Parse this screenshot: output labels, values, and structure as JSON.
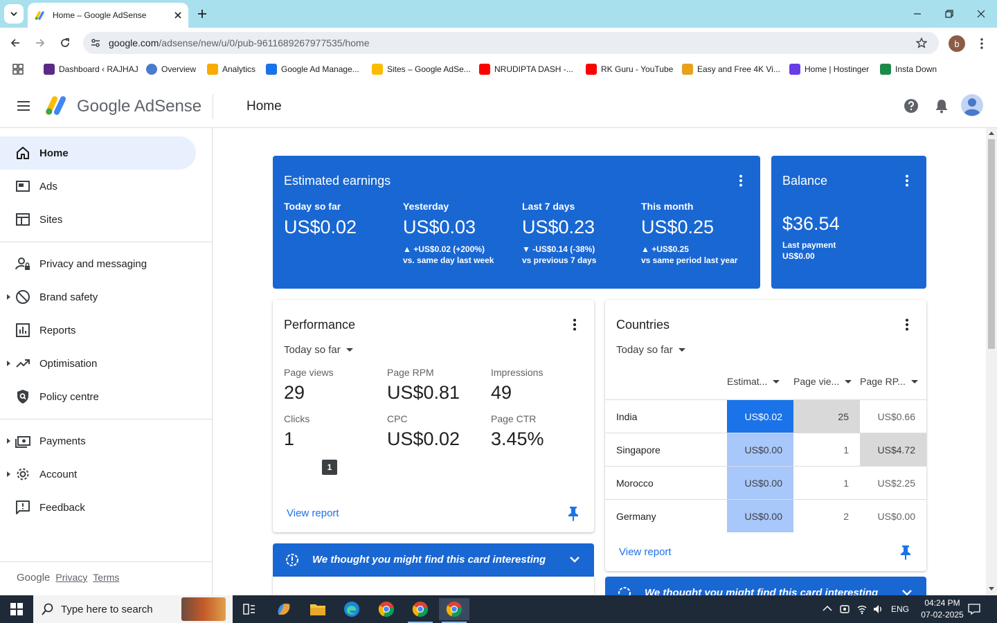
{
  "browser": {
    "tab_title": "Home – Google AdSense",
    "url_host": "google.com",
    "url_path": "/adsense/new/u/0/pub-9611689267977535/home",
    "profile_initial": "b"
  },
  "bookmarks": [
    {
      "label": "Dashboard ‹ RAJHAJ",
      "icon": "wordpress-icon",
      "color": "#5b2a86"
    },
    {
      "label": "Overview",
      "icon": "overview-icon",
      "color": "#4a7bd0"
    },
    {
      "label": "Analytics",
      "icon": "analytics-icon",
      "color": "#f9ab00"
    },
    {
      "label": "Google Ad Manage...",
      "icon": "ad-manager-icon",
      "color": "#1a73e8"
    },
    {
      "label": "Sites – Google AdSe...",
      "icon": "adsense-icon",
      "color": "#fbbc04"
    },
    {
      "label": "NRUDIPTA DASH -...",
      "icon": "youtube-icon",
      "color": "#ff0000"
    },
    {
      "label": "RK Guru - YouTube",
      "icon": "youtube-icon",
      "color": "#ff0000"
    },
    {
      "label": "Easy and Free 4K Vi...",
      "icon": "vidiq-icon",
      "color": "#e5a21a"
    },
    {
      "label": "Home | Hostinger",
      "icon": "hostinger-icon",
      "color": "#673de6"
    },
    {
      "label": "Insta Down",
      "icon": "instadown-icon",
      "color": "#1c8a4a"
    }
  ],
  "app": {
    "product_name": "Google AdSense",
    "page_title": "Home"
  },
  "sidebar": {
    "items": [
      {
        "label": "Home",
        "icon": "home-icon",
        "active": true
      },
      {
        "label": "Ads",
        "icon": "ads-icon"
      },
      {
        "label": "Sites",
        "icon": "sites-icon"
      },
      {
        "label": "Privacy and messaging",
        "icon": "privacy-icon"
      },
      {
        "label": "Brand safety",
        "icon": "block-icon",
        "expandable": true
      },
      {
        "label": "Reports",
        "icon": "reports-icon"
      },
      {
        "label": "Optimisation",
        "icon": "trending-icon",
        "expandable": true
      },
      {
        "label": "Policy centre",
        "icon": "policy-icon"
      },
      {
        "label": "Payments",
        "icon": "payments-icon",
        "expandable": true
      },
      {
        "label": "Account",
        "icon": "settings-icon",
        "expandable": true
      },
      {
        "label": "Feedback",
        "icon": "feedback-icon"
      }
    ],
    "footer": {
      "brand": "Google",
      "privacy": "Privacy",
      "terms": "Terms"
    }
  },
  "earnings": {
    "title": "Estimated earnings",
    "metrics": [
      {
        "label": "Today so far",
        "value": "US$0.02",
        "change": "",
        "compare": ""
      },
      {
        "label": "Yesterday",
        "value": "US$0.03",
        "change": "▲ +US$0.02 (+200%)",
        "compare": "vs. same day last week"
      },
      {
        "label": "Last 7 days",
        "value": "US$0.23",
        "change": "▼ -US$0.14 (-38%)",
        "compare": "vs previous 7 days"
      },
      {
        "label": "This month",
        "value": "US$0.25",
        "change": "▲ +US$0.25",
        "compare": "vs same period last year"
      }
    ]
  },
  "balance": {
    "title": "Balance",
    "value": "$36.54",
    "last_payment_label": "Last payment",
    "last_payment_value": "US$0.00"
  },
  "performance": {
    "title": "Performance",
    "range": "Today so far",
    "metrics": [
      {
        "label": "Page views",
        "value": "29"
      },
      {
        "label": "Page RPM",
        "value": "US$0.81"
      },
      {
        "label": "Impressions",
        "value": "49"
      },
      {
        "label": "Clicks",
        "value": "1"
      },
      {
        "label": "CPC",
        "value": "US$0.02"
      },
      {
        "label": "Page CTR",
        "value": "3.45%"
      }
    ],
    "tooltip": "1",
    "view_report": "View report"
  },
  "countries": {
    "title": "Countries",
    "range": "Today so far",
    "columns": [
      "Estimat...",
      "Page vie...",
      "Page RP..."
    ],
    "rows": [
      {
        "country": "India",
        "earnings": "US$0.02",
        "page_views": "25",
        "rpm": "US$0.66"
      },
      {
        "country": "Singapore",
        "earnings": "US$0.00",
        "page_views": "1",
        "rpm": "US$4.72"
      },
      {
        "country": "Morocco",
        "earnings": "US$0.00",
        "page_views": "1",
        "rpm": "US$2.25"
      },
      {
        "country": "Germany",
        "earnings": "US$0.00",
        "page_views": "2",
        "rpm": "US$0.00"
      }
    ],
    "view_report": "View report"
  },
  "interesting_banner": "We thought you might find this card interesting",
  "taskbar": {
    "search_placeholder": "Type here to search",
    "language": "ENG",
    "time": "04:24 PM",
    "date": "07-02-2025"
  },
  "colors": {
    "adsense_blue": "#1967d2",
    "heat_strong": "#1a73e8",
    "heat_light": "#a8c7fa",
    "heat_grey": "#d9d9d9"
  }
}
